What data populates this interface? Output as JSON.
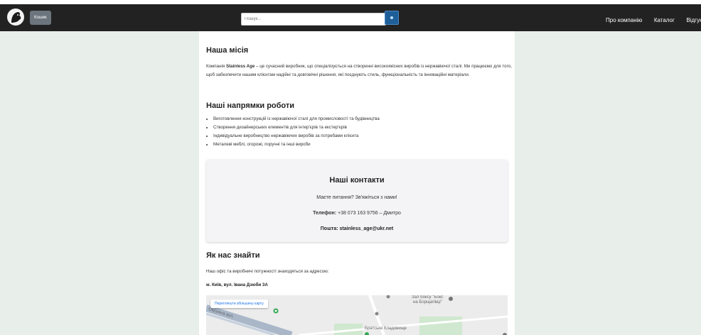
{
  "header": {
    "cart_label": "Кошик",
    "search_placeholder": "Пошук...",
    "nav": [
      "Про компанію",
      "Каталог",
      "Відгуки"
    ]
  },
  "mission": {
    "title": "Наша місія",
    "text_prefix": "Компанія ",
    "brand": "Stainless Age",
    "text_rest": " – це сучасний виробник, що спеціалізується на створенні високоякісних виробів із нержавіючої сталі. Ми працюємо для того, щоб забезпечити нашим клієнтам надійні та довговічні рішення, які поєднують стиль, функціональність та інноваційні матеріали."
  },
  "directions": {
    "title": "Наші напрямки роботи",
    "items": [
      "Виготовлення конструкцій із нержавіючої сталі для промисловості та будівництва",
      "Створення дизайнерських елементів для інтер'єрів та екстер'єрів",
      "Індивідуальне виробництво нержавіючих виробів за потребами клієнта",
      "Металеві меблі, огорожі, поручні та інші вироби"
    ]
  },
  "contacts": {
    "title": "Наші контакти",
    "question": "Маєте питання? Зв'яжіться з нами!",
    "phone_label": "Телефон:",
    "phone_value": " +38 073 163 9756 – Дмитро",
    "email_label": "Пошта: ",
    "email_value": "stainless_age@ukr.net"
  },
  "location": {
    "title": "Як нас знайти",
    "text": "Наш офіс та виробничі потужності знаходяться за адресою:",
    "address": "м. Київ, вул. Івана Дзюби 3А"
  },
  "map": {
    "button": "Переглянути збільшену карту",
    "label_gym_1": "Зал боксу \"Бокс",
    "label_gym_2": "на Борщагівці\"",
    "label_cemetery": "Братське Кладовище",
    "label_street": "Окружна вул.",
    "colors": {
      "road": "#a9b7c9",
      "park": "#cfe8cf",
      "pin": "#34a853"
    }
  }
}
